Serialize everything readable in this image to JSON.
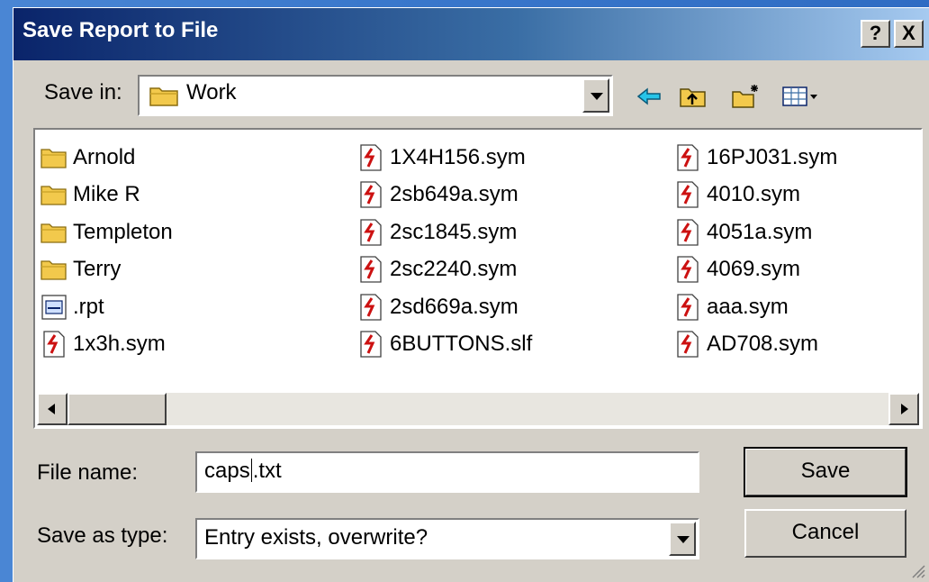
{
  "dialog": {
    "title": "Save Report to File",
    "help_label": "?",
    "close_label": "X"
  },
  "save_in": {
    "label": "Save in:",
    "value": "Work",
    "icon": "folder-icon"
  },
  "toolbar": {
    "buttons": [
      "back-icon",
      "up-folder-icon",
      "new-folder-icon",
      "view-menu-icon"
    ]
  },
  "files": {
    "columns": [
      [
        {
          "name": "Arnold",
          "type": "folder"
        },
        {
          "name": "Mike R",
          "type": "folder"
        },
        {
          "name": "Templeton",
          "type": "folder"
        },
        {
          "name": "Terry",
          "type": "folder"
        },
        {
          "name": ".rpt",
          "type": "report"
        },
        {
          "name": "1x3h.sym",
          "type": "sym"
        }
      ],
      [
        {
          "name": "1X4H156.sym",
          "type": "sym"
        },
        {
          "name": "2sb649a.sym",
          "type": "sym"
        },
        {
          "name": "2sc1845.sym",
          "type": "sym"
        },
        {
          "name": "2sc2240.sym",
          "type": "sym"
        },
        {
          "name": "2sd669a.sym",
          "type": "sym"
        },
        {
          "name": "6BUTTONS.slf",
          "type": "sym"
        }
      ],
      [
        {
          "name": "16PJ031.sym",
          "type": "sym"
        },
        {
          "name": "4010.sym",
          "type": "sym"
        },
        {
          "name": "4051a.sym",
          "type": "sym"
        },
        {
          "name": "4069.sym",
          "type": "sym"
        },
        {
          "name": "aaa.sym",
          "type": "sym"
        },
        {
          "name": "AD708.sym",
          "type": "sym"
        }
      ]
    ]
  },
  "form": {
    "file_name_label": "File name:",
    "file_name_before_caret": "caps",
    "file_name_after_caret": ".txt",
    "save_type_label": "Save as type:",
    "save_type_value": "Entry exists, overwrite?",
    "save_button": "Save",
    "cancel_button": "Cancel"
  },
  "colors": {
    "title_start": "#0a246a",
    "title_end": "#a6caf0",
    "dialog_face": "#d4d0c8",
    "folder": "#f2c94c",
    "sym_arrow": "#cc1111"
  }
}
